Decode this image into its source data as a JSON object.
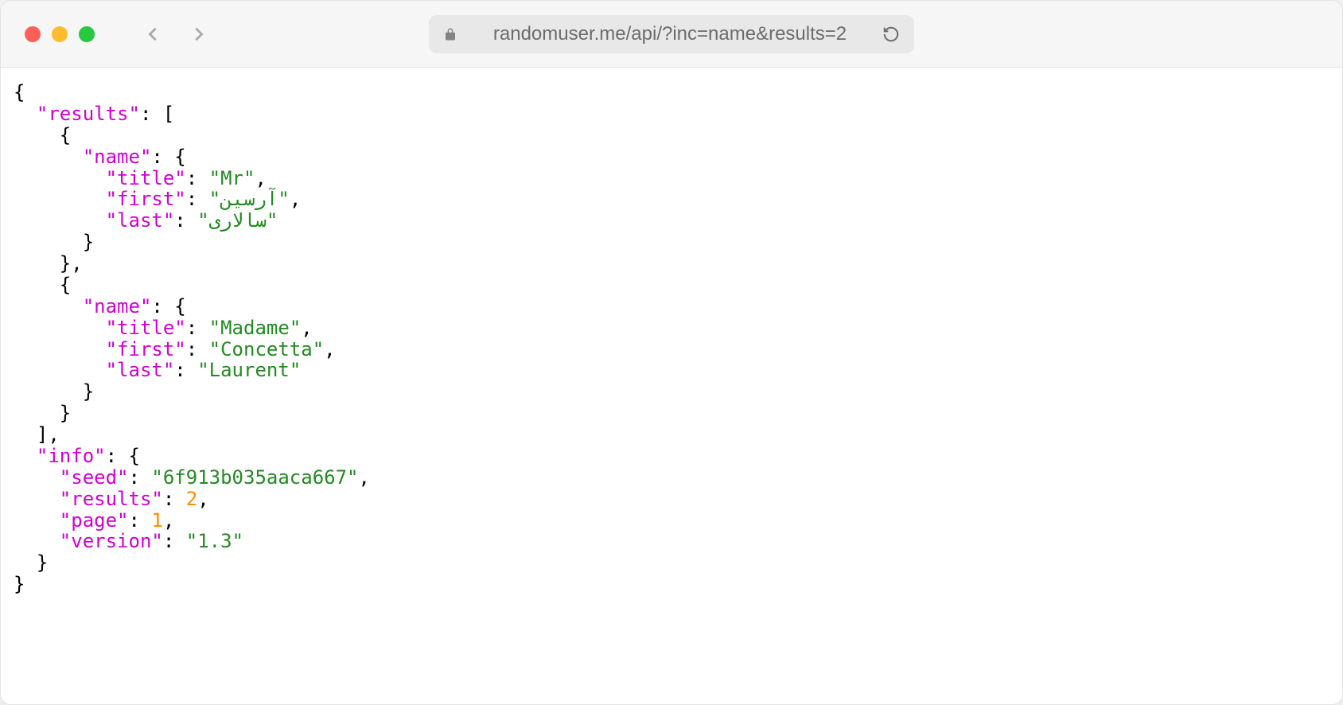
{
  "url": "randomuser.me/api/?inc=name&results=2",
  "json": {
    "results": [
      {
        "name": {
          "title": "Mr",
          "first": "آرسین",
          "last": "سالاری"
        }
      },
      {
        "name": {
          "title": "Madame",
          "first": "Concetta",
          "last": "Laurent"
        }
      }
    ],
    "info": {
      "seed": "6f913b035aaca667",
      "results": 2,
      "page": 1,
      "version": "1.3"
    }
  }
}
